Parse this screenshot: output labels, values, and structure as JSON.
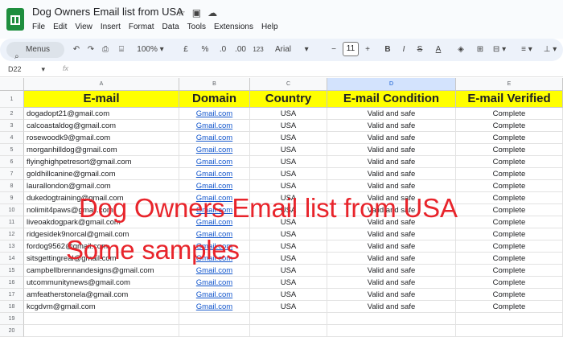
{
  "app": {
    "title": "Dog Owners Email list from USA",
    "menu": [
      "File",
      "Edit",
      "View",
      "Insert",
      "Format",
      "Data",
      "Tools",
      "Extensions",
      "Help"
    ]
  },
  "toolbar": {
    "menus_label": "Menus",
    "zoom": "100%",
    "currency": "£",
    "percent": "%",
    "dec_less": ".0",
    "dec_more": ".00",
    "number_format": "123",
    "font": "Arial",
    "font_size": "11"
  },
  "formula": {
    "cell_ref": "D22",
    "fx": "fx"
  },
  "columns": [
    "A",
    "B",
    "C",
    "D",
    "E"
  ],
  "headers": [
    "E-mail",
    "Domain",
    "Country",
    "E-mail Condition",
    "E-mail Verified"
  ],
  "rows": [
    {
      "email": "dogadopt21@gmail.com",
      "domain": "Gmail.com",
      "country": "USA",
      "condition": "Valid and safe",
      "verified": "Complete"
    },
    {
      "email": "calcoastaldog@gmail.com",
      "domain": "Gmail.com",
      "country": "USA",
      "condition": "Valid and safe",
      "verified": "Complete"
    },
    {
      "email": "rosewoodk9@gmail.com",
      "domain": "Gmail.com",
      "country": "USA",
      "condition": "Valid and safe",
      "verified": "Complete"
    },
    {
      "email": "morganhilldog@gmail.com",
      "domain": "Gmail.com",
      "country": "USA",
      "condition": "Valid and safe",
      "verified": "Complete"
    },
    {
      "email": "flyinghighpetresort@gmail.com",
      "domain": "Gmail.com",
      "country": "USA",
      "condition": "Valid and safe",
      "verified": "Complete"
    },
    {
      "email": "goldhillcanine@gmail.com",
      "domain": "Gmail.com",
      "country": "USA",
      "condition": "Valid and safe",
      "verified": "Complete"
    },
    {
      "email": "laurallondon@gmail.com",
      "domain": "Gmail.com",
      "country": "USA",
      "condition": "Valid and safe",
      "verified": "Complete"
    },
    {
      "email": "dukedogtraining@gmail.com",
      "domain": "Gmail.com",
      "country": "USA",
      "condition": "Valid and safe",
      "verified": "Complete"
    },
    {
      "email": "nolimit4paws@gmail.com",
      "domain": "Gmail.com",
      "country": "USA",
      "condition": "Valid and safe",
      "verified": "Complete"
    },
    {
      "email": "liveoakdogpark@gmail.com",
      "domain": "Gmail.com",
      "country": "USA",
      "condition": "Valid and safe",
      "verified": "Complete"
    },
    {
      "email": "ridgesidek9norcal@gmail.com",
      "domain": "Gmail.com",
      "country": "USA",
      "condition": "Valid and safe",
      "verified": "Complete"
    },
    {
      "email": "fordog9562@gmail.com",
      "domain": "Gmail.com",
      "country": "USA",
      "condition": "Valid and safe",
      "verified": "Complete"
    },
    {
      "email": "sitsgettingreal@gmail.com",
      "domain": "Gmail.com",
      "country": "USA",
      "condition": "Valid and safe",
      "verified": "Complete"
    },
    {
      "email": "campbellbrennandesigns@gmail.com",
      "domain": "Gmail.com",
      "country": "USA",
      "condition": "Valid and safe",
      "verified": "Complete"
    },
    {
      "email": "utcommunitynews@gmail.com",
      "domain": "Gmail.com",
      "country": "USA",
      "condition": "Valid and safe",
      "verified": "Complete"
    },
    {
      "email": "amfeatherstonela@gmail.com",
      "domain": "Gmail.com",
      "country": "USA",
      "condition": "Valid and safe",
      "verified": "Complete"
    },
    {
      "email": "kcgdvm@gmail.com",
      "domain": "Gmail.com",
      "country": "USA",
      "condition": "Valid and safe",
      "verified": "Complete"
    }
  ],
  "overlay": {
    "line1": "Dog Owners Email list from USA",
    "line2": "Some samples"
  },
  "colors": {
    "header_fill": "#ffff00",
    "overlay_text": "#e8242b",
    "link": "#1155cc"
  }
}
